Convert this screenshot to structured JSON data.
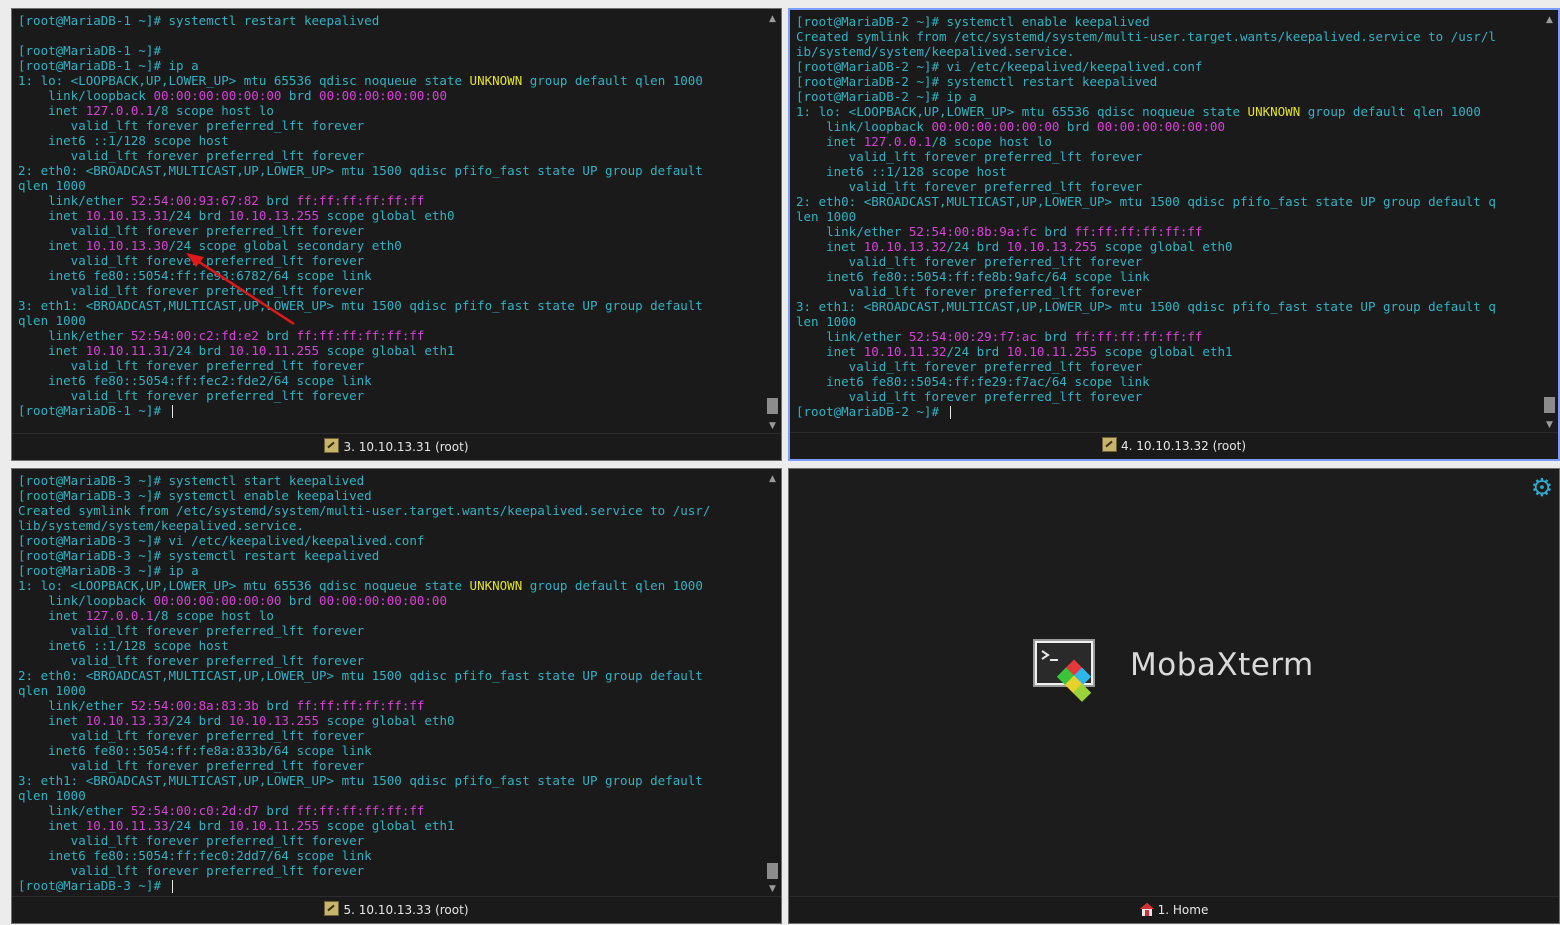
{
  "theme": {
    "cyan": "#31b2c4",
    "magenta": "#d840d8",
    "yellow": "#e3e31e",
    "active_border": "#7a9cff"
  },
  "pane1": {
    "tab_label": "3. 10.10.13.31 (root)",
    "lines": [
      {
        "segs": [
          {
            "t": "[root@MariaDB-1 ~]# systemctl restart keepalived"
          }
        ]
      },
      {
        "segs": [
          {
            "t": ""
          }
        ]
      },
      {
        "segs": [
          {
            "t": "[root@MariaDB-1 ~]#"
          }
        ]
      },
      {
        "segs": [
          {
            "t": "[root@MariaDB-1 ~]# ip a"
          }
        ]
      },
      {
        "segs": [
          {
            "t": "1: lo: <LOOPBACK,UP,LOWER_UP> mtu 65536 qdisc noqueue state "
          },
          {
            "t": "UNKNOWN",
            "c": "y"
          },
          {
            "t": " group default qlen 1000"
          }
        ]
      },
      {
        "segs": [
          {
            "t": "    link/loopback "
          },
          {
            "t": "00:00:00:00:00:00",
            "c": "m"
          },
          {
            "t": " brd "
          },
          {
            "t": "00:00:00:00:00:00",
            "c": "m"
          }
        ]
      },
      {
        "segs": [
          {
            "t": "    inet "
          },
          {
            "t": "127.0.0.1",
            "c": "m"
          },
          {
            "t": "/8 scope host lo"
          }
        ]
      },
      {
        "segs": [
          {
            "t": "       valid_lft forever preferred_lft forever"
          }
        ]
      },
      {
        "segs": [
          {
            "t": "    inet6 ::1/128 scope host"
          }
        ]
      },
      {
        "segs": [
          {
            "t": "       valid_lft forever preferred_lft forever"
          }
        ]
      },
      {
        "segs": [
          {
            "t": "2: eth0: <BROADCAST,MULTICAST,UP,LOWER_UP> mtu 1500 qdisc pfifo_fast state UP group default"
          }
        ]
      },
      {
        "segs": [
          {
            "t": "qlen 1000"
          }
        ]
      },
      {
        "segs": [
          {
            "t": "    link/ether "
          },
          {
            "t": "52:54:00:93:67:82",
            "c": "m"
          },
          {
            "t": " brd "
          },
          {
            "t": "ff:ff:ff:ff:ff:ff",
            "c": "m"
          }
        ]
      },
      {
        "segs": [
          {
            "t": "    inet "
          },
          {
            "t": "10.10.13.31",
            "c": "m"
          },
          {
            "t": "/24 brd "
          },
          {
            "t": "10.10.13.255",
            "c": "m"
          },
          {
            "t": " scope global eth0"
          }
        ]
      },
      {
        "segs": [
          {
            "t": "       valid_lft forever preferred_lft forever"
          }
        ]
      },
      {
        "segs": [
          {
            "t": "    inet "
          },
          {
            "t": "10.10.13.30",
            "c": "m"
          },
          {
            "t": "/24 scope global secondary eth0"
          }
        ]
      },
      {
        "segs": [
          {
            "t": "       valid_lft forever preferred_lft forever"
          }
        ]
      },
      {
        "segs": [
          {
            "t": "    inet6 fe80::5054:ff:fe93:6782/64 scope link"
          }
        ]
      },
      {
        "segs": [
          {
            "t": "       valid_lft forever preferred_lft forever"
          }
        ]
      },
      {
        "segs": [
          {
            "t": "3: eth1: <BROADCAST,MULTICAST,UP,LOWER_UP> mtu 1500 qdisc pfifo_fast state UP group default"
          }
        ]
      },
      {
        "segs": [
          {
            "t": "qlen 1000"
          }
        ]
      },
      {
        "segs": [
          {
            "t": "    link/ether "
          },
          {
            "t": "52:54:00:c2:fd:e2",
            "c": "m"
          },
          {
            "t": " brd "
          },
          {
            "t": "ff:ff:ff:ff:ff:ff",
            "c": "m"
          }
        ]
      },
      {
        "segs": [
          {
            "t": "    inet "
          },
          {
            "t": "10.10.11.31",
            "c": "m"
          },
          {
            "t": "/24 brd "
          },
          {
            "t": "10.10.11.255",
            "c": "m"
          },
          {
            "t": " scope global eth1"
          }
        ]
      },
      {
        "segs": [
          {
            "t": "       valid_lft forever preferred_lft forever"
          }
        ]
      },
      {
        "segs": [
          {
            "t": "    inet6 fe80::5054:ff:fec2:fde2/64 scope link"
          }
        ]
      },
      {
        "segs": [
          {
            "t": "       valid_lft forever preferred_lft forever"
          }
        ]
      },
      {
        "segs": [
          {
            "t": "[root@MariaDB-1 ~]# "
          }
        ],
        "cursor": true
      }
    ]
  },
  "pane2": {
    "tab_label": "4. 10.10.13.32 (root)",
    "lines": [
      {
        "segs": [
          {
            "t": "[root@MariaDB-2 ~]# systemctl enable keepalived"
          }
        ]
      },
      {
        "segs": [
          {
            "t": "Created symlink from /etc/systemd/system/multi-user.target.wants/keepalived.service to /usr/l"
          }
        ]
      },
      {
        "segs": [
          {
            "t": "ib/systemd/system/keepalived.service."
          }
        ]
      },
      {
        "segs": [
          {
            "t": "[root@MariaDB-2 ~]# vi /etc/keepalived/keepalived.conf"
          }
        ]
      },
      {
        "segs": [
          {
            "t": "[root@MariaDB-2 ~]# systemctl restart keepalived"
          }
        ]
      },
      {
        "segs": [
          {
            "t": "[root@MariaDB-2 ~]# ip a"
          }
        ]
      },
      {
        "segs": [
          {
            "t": "1: lo: <LOOPBACK,UP,LOWER_UP> mtu 65536 qdisc noqueue state "
          },
          {
            "t": "UNKNOWN",
            "c": "y"
          },
          {
            "t": " group default qlen 1000"
          }
        ]
      },
      {
        "segs": [
          {
            "t": "    link/loopback "
          },
          {
            "t": "00:00:00:00:00:00",
            "c": "m"
          },
          {
            "t": " brd "
          },
          {
            "t": "00:00:00:00:00:00",
            "c": "m"
          }
        ]
      },
      {
        "segs": [
          {
            "t": "    inet "
          },
          {
            "t": "127.0.0.1",
            "c": "m"
          },
          {
            "t": "/8 scope host lo"
          }
        ]
      },
      {
        "segs": [
          {
            "t": "       valid_lft forever preferred_lft forever"
          }
        ]
      },
      {
        "segs": [
          {
            "t": "    inet6 ::1/128 scope host"
          }
        ]
      },
      {
        "segs": [
          {
            "t": "       valid_lft forever preferred_lft forever"
          }
        ]
      },
      {
        "segs": [
          {
            "t": "2: eth0: <BROADCAST,MULTICAST,UP,LOWER_UP> mtu 1500 qdisc pfifo_fast state UP group default q"
          }
        ]
      },
      {
        "segs": [
          {
            "t": "len 1000"
          }
        ]
      },
      {
        "segs": [
          {
            "t": "    link/ether "
          },
          {
            "t": "52:54:00:8b:9a:fc",
            "c": "m"
          },
          {
            "t": " brd "
          },
          {
            "t": "ff:ff:ff:ff:ff:ff",
            "c": "m"
          }
        ]
      },
      {
        "segs": [
          {
            "t": "    inet "
          },
          {
            "t": "10.10.13.32",
            "c": "m"
          },
          {
            "t": "/24 brd "
          },
          {
            "t": "10.10.13.255",
            "c": "m"
          },
          {
            "t": " scope global eth0"
          }
        ]
      },
      {
        "segs": [
          {
            "t": "       valid_lft forever preferred_lft forever"
          }
        ]
      },
      {
        "segs": [
          {
            "t": "    inet6 fe80::5054:ff:fe8b:9afc/64 scope link"
          }
        ]
      },
      {
        "segs": [
          {
            "t": "       valid_lft forever preferred_lft forever"
          }
        ]
      },
      {
        "segs": [
          {
            "t": "3: eth1: <BROADCAST,MULTICAST,UP,LOWER_UP> mtu 1500 qdisc pfifo_fast state UP group default q"
          }
        ]
      },
      {
        "segs": [
          {
            "t": "len 1000"
          }
        ]
      },
      {
        "segs": [
          {
            "t": "    link/ether "
          },
          {
            "t": "52:54:00:29:f7:ac",
            "c": "m"
          },
          {
            "t": " brd "
          },
          {
            "t": "ff:ff:ff:ff:ff:ff",
            "c": "m"
          }
        ]
      },
      {
        "segs": [
          {
            "t": "    inet "
          },
          {
            "t": "10.10.11.32",
            "c": "m"
          },
          {
            "t": "/24 brd "
          },
          {
            "t": "10.10.11.255",
            "c": "m"
          },
          {
            "t": " scope global eth1"
          }
        ]
      },
      {
        "segs": [
          {
            "t": "       valid_lft forever preferred_lft forever"
          }
        ]
      },
      {
        "segs": [
          {
            "t": "    inet6 fe80::5054:ff:fe29:f7ac/64 scope link"
          }
        ]
      },
      {
        "segs": [
          {
            "t": "       valid_lft forever preferred_lft forever"
          }
        ]
      },
      {
        "segs": [
          {
            "t": "[root@MariaDB-2 ~]# "
          }
        ],
        "cursor": true
      }
    ]
  },
  "pane3": {
    "tab_label": "5. 10.10.13.33 (root)",
    "lines": [
      {
        "segs": [
          {
            "t": "[root@MariaDB-3 ~]# systemctl start keepalived"
          }
        ]
      },
      {
        "segs": [
          {
            "t": "[root@MariaDB-3 ~]# systemctl enable keepalived"
          }
        ]
      },
      {
        "segs": [
          {
            "t": "Created symlink from /etc/systemd/system/multi-user.target.wants/keepalived.service to /usr/"
          }
        ]
      },
      {
        "segs": [
          {
            "t": "lib/systemd/system/keepalived.service."
          }
        ]
      },
      {
        "segs": [
          {
            "t": "[root@MariaDB-3 ~]# vi /etc/keepalived/keepalived.conf"
          }
        ]
      },
      {
        "segs": [
          {
            "t": "[root@MariaDB-3 ~]# systemctl restart keepalived"
          }
        ]
      },
      {
        "segs": [
          {
            "t": "[root@MariaDB-3 ~]# ip a"
          }
        ]
      },
      {
        "segs": [
          {
            "t": "1: lo: <LOOPBACK,UP,LOWER_UP> mtu 65536 qdisc noqueue state "
          },
          {
            "t": "UNKNOWN",
            "c": "y"
          },
          {
            "t": " group default qlen 1000"
          }
        ]
      },
      {
        "segs": [
          {
            "t": "    link/loopback "
          },
          {
            "t": "00:00:00:00:00:00",
            "c": "m"
          },
          {
            "t": " brd "
          },
          {
            "t": "00:00:00:00:00:00",
            "c": "m"
          }
        ]
      },
      {
        "segs": [
          {
            "t": "    inet "
          },
          {
            "t": "127.0.0.1",
            "c": "m"
          },
          {
            "t": "/8 scope host lo"
          }
        ]
      },
      {
        "segs": [
          {
            "t": "       valid_lft forever preferred_lft forever"
          }
        ]
      },
      {
        "segs": [
          {
            "t": "    inet6 ::1/128 scope host"
          }
        ]
      },
      {
        "segs": [
          {
            "t": "       valid_lft forever preferred_lft forever"
          }
        ]
      },
      {
        "segs": [
          {
            "t": "2: eth0: <BROADCAST,MULTICAST,UP,LOWER_UP> mtu 1500 qdisc pfifo_fast state UP group default"
          }
        ]
      },
      {
        "segs": [
          {
            "t": "qlen 1000"
          }
        ]
      },
      {
        "segs": [
          {
            "t": "    link/ether "
          },
          {
            "t": "52:54:00:8a:83:3b",
            "c": "m"
          },
          {
            "t": " brd "
          },
          {
            "t": "ff:ff:ff:ff:ff:ff",
            "c": "m"
          }
        ]
      },
      {
        "segs": [
          {
            "t": "    inet "
          },
          {
            "t": "10.10.13.33",
            "c": "m"
          },
          {
            "t": "/24 brd "
          },
          {
            "t": "10.10.13.255",
            "c": "m"
          },
          {
            "t": " scope global eth0"
          }
        ]
      },
      {
        "segs": [
          {
            "t": "       valid_lft forever preferred_lft forever"
          }
        ]
      },
      {
        "segs": [
          {
            "t": "    inet6 fe80::5054:ff:fe8a:833b/64 scope link"
          }
        ]
      },
      {
        "segs": [
          {
            "t": "       valid_lft forever preferred_lft forever"
          }
        ]
      },
      {
        "segs": [
          {
            "t": "3: eth1: <BROADCAST,MULTICAST,UP,LOWER_UP> mtu 1500 qdisc pfifo_fast state UP group default"
          }
        ]
      },
      {
        "segs": [
          {
            "t": "qlen 1000"
          }
        ]
      },
      {
        "segs": [
          {
            "t": "    link/ether "
          },
          {
            "t": "52:54:00:c0:2d:d7",
            "c": "m"
          },
          {
            "t": " brd "
          },
          {
            "t": "ff:ff:ff:ff:ff:ff",
            "c": "m"
          }
        ]
      },
      {
        "segs": [
          {
            "t": "    inet "
          },
          {
            "t": "10.10.11.33",
            "c": "m"
          },
          {
            "t": "/24 brd "
          },
          {
            "t": "10.10.11.255",
            "c": "m"
          },
          {
            "t": " scope global eth1"
          }
        ]
      },
      {
        "segs": [
          {
            "t": "       valid_lft forever preferred_lft forever"
          }
        ]
      },
      {
        "segs": [
          {
            "t": "    inet6 fe80::5054:ff:fec0:2dd7/64 scope link"
          }
        ]
      },
      {
        "segs": [
          {
            "t": "       valid_lft forever preferred_lft forever"
          }
        ]
      },
      {
        "segs": [
          {
            "t": "[root@MariaDB-3 ~]# "
          }
        ],
        "cursor": true
      }
    ]
  },
  "home": {
    "tab_label": "1. Home",
    "app_name": "MobaXterm"
  }
}
